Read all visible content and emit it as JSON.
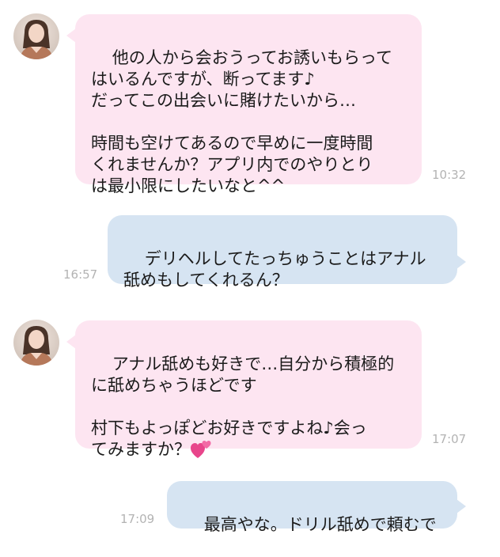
{
  "messages": [
    {
      "direction": "incoming",
      "text": "他の人から会おうってお誘いもらって\nはいるんですが、断ってます♪\nだってこの出会いに賭けたいから…\n\n時間も空けてあるので早めに一度時間\nくれませんか？アプリ内でのやりとり\nは最小限にしたいなと^^",
      "time": "10:32"
    },
    {
      "direction": "outgoing",
      "text": "デリヘルしてたっちゅうことはアナル\n舐めもしてくれるん？",
      "time": "16:57"
    },
    {
      "direction": "incoming",
      "text": "アナル舐めも好きで…自分から積極的\nに舐めちゃうほどです\n\n村下もよっぽどお好きですよね♪会っ\nてみますか？",
      "emoji": "two-hearts-icon",
      "time": "17:07"
    },
    {
      "direction": "outgoing",
      "text": "最高やな。ドリル舐めで頼むで",
      "time": "17:09"
    }
  ],
  "colors": {
    "incoming_bubble": "#fde5f1",
    "outgoing_bubble": "#d6e4f2",
    "timestamp": "#b3b3b3",
    "heart": "#e8458b"
  }
}
